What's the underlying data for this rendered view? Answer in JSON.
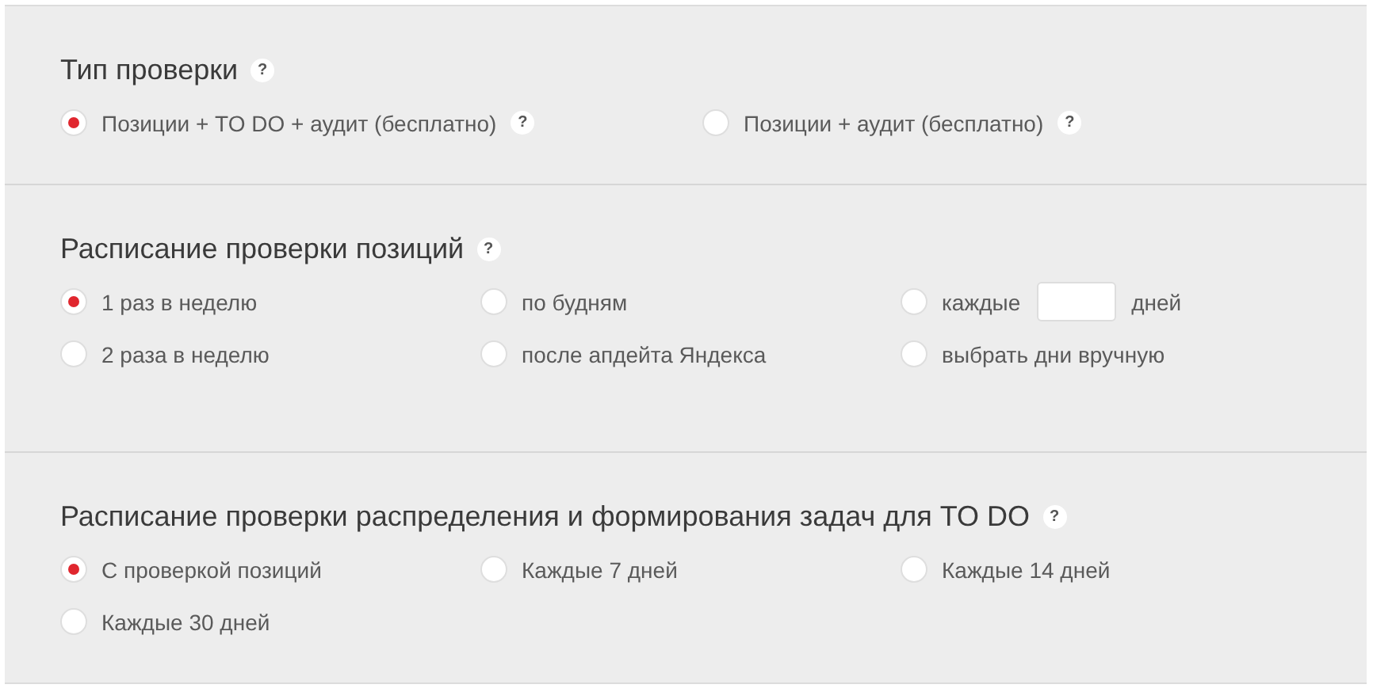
{
  "sections": [
    {
      "title": "Тип проверки",
      "help": "?",
      "kind": "wide",
      "options": [
        {
          "kind": "radio",
          "label": "Позиции + TO DO + аудит (бесплатно)",
          "selected": true,
          "help": "?"
        },
        {
          "kind": "radio",
          "label": "Позиции + аудит (бесплатно)",
          "selected": false,
          "help": "?"
        }
      ]
    },
    {
      "title": "Расписание проверки позиций",
      "help": "?",
      "kind": "grid",
      "options": [
        {
          "kind": "radio",
          "label": "1 раз в неделю",
          "selected": true
        },
        {
          "kind": "radio",
          "label": "по будням",
          "selected": false
        },
        {
          "kind": "interval",
          "label": "каждые",
          "suffix": "дней",
          "selected": false
        },
        {
          "kind": "radio",
          "label": "2 раза в неделю",
          "selected": false
        },
        {
          "kind": "radio",
          "label": "после апдейта Яндекса",
          "selected": false
        },
        {
          "kind": "radio",
          "label": "выбрать дни вручную",
          "selected": false
        }
      ]
    },
    {
      "title": "Расписание проверки распределения и формирования задач для TO DO",
      "help": "?",
      "kind": "grid",
      "options": [
        {
          "kind": "radio",
          "label": "С проверкой позиций",
          "selected": true
        },
        {
          "kind": "radio",
          "label": "Каждые 7 дней",
          "selected": false
        },
        {
          "kind": "radio",
          "label": "Каждые 14 дней",
          "selected": false
        },
        {
          "kind": "radio",
          "label": "Каждые 30 дней",
          "selected": false
        }
      ]
    }
  ]
}
